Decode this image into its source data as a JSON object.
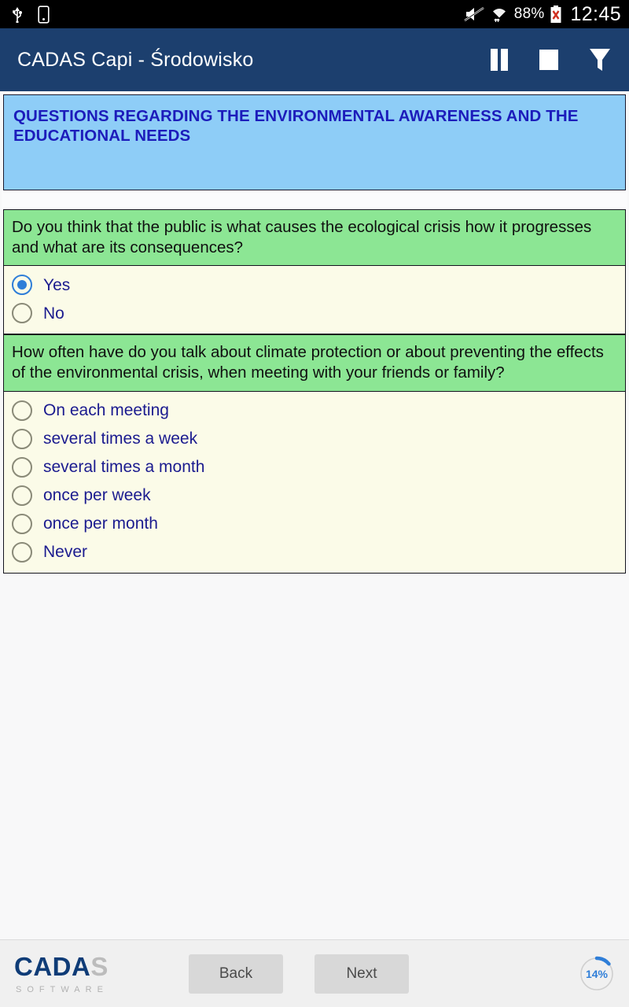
{
  "statusbar": {
    "icons_left": [
      "usb-icon",
      "sdcard-icon"
    ],
    "icons_right": [
      "mute-icon",
      "wifi-data-icon",
      "battery-error-icon"
    ],
    "battery": "88%",
    "clock": "12:45"
  },
  "appbar": {
    "title": "CADAS Capi - Środowisko",
    "actions": [
      {
        "name": "pause-button",
        "icon": "pause-icon"
      },
      {
        "name": "stop-button",
        "icon": "stop-icon"
      },
      {
        "name": "filter-button",
        "icon": "funnel-icon"
      }
    ]
  },
  "section": {
    "title": "QUESTIONS REGARDING THE ENVIRONMENTAL AWARENESS AND THE EDUCATIONAL NEEDS"
  },
  "questions": [
    {
      "text": "Do you think that the public is what causes the ecological crisis how it progresses and what are its consequences?",
      "options": [
        {
          "label": "Yes",
          "selected": true
        },
        {
          "label": "No",
          "selected": false
        }
      ]
    },
    {
      "text": "How often have do you talk about climate protection or about preventing the effects of the environmental crisis, when meeting with your friends or family?",
      "options": [
        {
          "label": "On each meeting",
          "selected": false
        },
        {
          "label": "several times a week",
          "selected": false
        },
        {
          "label": "several times a month",
          "selected": false
        },
        {
          "label": "once per week",
          "selected": false
        },
        {
          "label": "once per month",
          "selected": false
        },
        {
          "label": "Never",
          "selected": false
        }
      ]
    }
  ],
  "bottombar": {
    "logo_main_dark": "CADA",
    "logo_main_light": "S",
    "logo_sub": "SOFTWARE",
    "back_label": "Back",
    "next_label": "Next",
    "progress_label": "14%",
    "progress_percent": 14
  },
  "colors": {
    "appbar": "#1c3f6e",
    "section_banner": "#8ecdf7",
    "section_text": "#1c1cbb",
    "question_head": "#8ce694",
    "options_bg": "#fbfbe8",
    "option_text": "#1b1b8f",
    "accent": "#2f7ed8",
    "page_bg": "#f8f8f9"
  }
}
